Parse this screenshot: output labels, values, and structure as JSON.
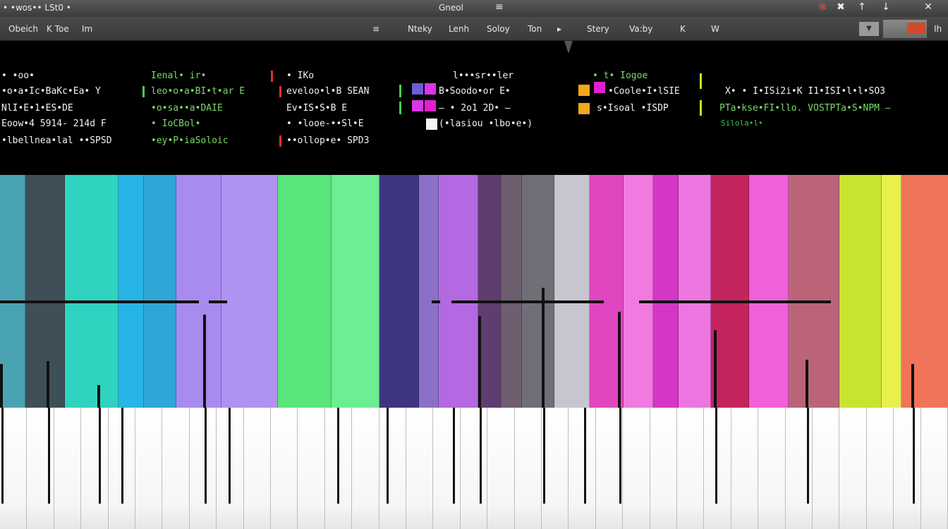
{
  "titlebar": {
    "left": "• •wos•• LSt0 •",
    "center": "Gneol",
    "menu_icon": "≡"
  },
  "window_controls": [
    {
      "name": "record-icon",
      "glyph": "⊗"
    },
    {
      "name": "close-x-icon",
      "glyph": "✖"
    },
    {
      "name": "pin-icon",
      "glyph": "↑"
    },
    {
      "name": "minimize-icon",
      "glyph": "↓"
    },
    {
      "name": "close-icon",
      "glyph": "✕"
    }
  ],
  "menubar": {
    "left": [
      "Obeich",
      "K Toe",
      "Im"
    ],
    "mid_icon": "≡",
    "mid": [
      "Nteky",
      "Lenh",
      "Soloy",
      "Ton"
    ],
    "mid_arrow": "▸",
    "right": [
      "Stery",
      "Va:by",
      "K",
      "W"
    ],
    "dropdown": "▼",
    "end": "Ih"
  },
  "info": {
    "col1": [
      "• •oo•",
      "•o•a•Ic•BaKc•Ea• Y",
      "NlI•E•1•ES•DE",
      "Eoow•4 5914- 214d F",
      "•lbellnea•lal ••SPSD"
    ],
    "col2": [
      "Ienal• ir•",
      "leo•o•a•BI•t•ar E",
      "•o•sa••a•DAIE",
      "• IoCBol•",
      "•ey•P•iaSoloic"
    ],
    "col3": [
      "• IKo",
      "eveloo•l•B SEAN",
      "Ev•IS•S•B E",
      "• •looe-••Sl•E",
      "••ollop•e• SPD3"
    ],
    "col4": [
      "l•••sr••ler",
      "B•Soodo•or E•",
      "—   • 2o1 2D• —",
      "(•lasiou •lbo•e•)"
    ],
    "col5": [
      "• t• Iogoe",
      "•Coole•I•lSIE",
      "s•Isoal •ISDP"
    ],
    "col6": [
      "X• •  I•ISi2i•K  I1•ISI•l•l•SO3",
      "PTa•kse•FI•llo. VOSTPTa•S•NPM —",
      "Silola•l•"
    ]
  },
  "colors": {
    "swatches": [
      "#6c5ed6",
      "#d836e8",
      "#f4f4f4",
      "#f0a81c",
      "#e020d0",
      "#58d84e",
      "#e4ee20"
    ],
    "dividers": [
      "#40d050",
      "#e03030",
      "#d4e020"
    ]
  },
  "piano_roll": {
    "notes": [
      {
        "color": "#4aa3b2"
      },
      {
        "color": "#3f4f58"
      },
      {
        "color": "#2fd3bf"
      },
      {
        "color": "#27b4e6"
      },
      {
        "color": "#2fa6d6"
      },
      {
        "color": "#a98aee"
      },
      {
        "color": "#b092f0"
      },
      {
        "color": "#59e57a"
      },
      {
        "color": "#6cee92"
      },
      {
        "color": "#3e3680"
      },
      {
        "color": "#8c70c8"
      },
      {
        "color": "#b468e2"
      },
      {
        "color": "#5e3e70"
      },
      {
        "color": "#6d5e70"
      },
      {
        "color": "#6f6f78"
      },
      {
        "color": "#c6c6ce"
      },
      {
        "color": "#e046bf"
      },
      {
        "color": "#f07ae0"
      },
      {
        "color": "#d436c5"
      },
      {
        "color": "#ee76e0"
      },
      {
        "color": "#c3245e"
      },
      {
        "color": "#f060d8"
      },
      {
        "color": "#bb6478"
      },
      {
        "color": "#c9e42e"
      },
      {
        "color": "#e8f050"
      },
      {
        "color": "#f0745a"
      }
    ]
  },
  "keyboard": {
    "white_key_count": 35
  }
}
